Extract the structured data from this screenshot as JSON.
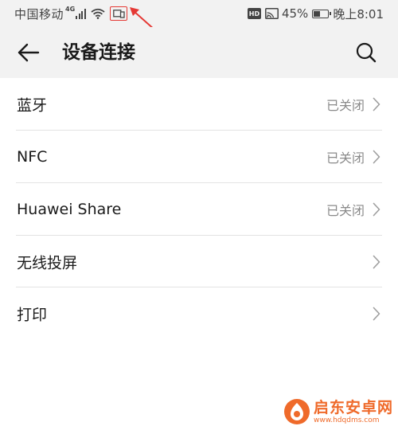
{
  "status_bar": {
    "carrier": "中国移动",
    "network_type": "4G",
    "battery_percent_label": "45%",
    "battery_level": 0.45,
    "hd_badge": "HD",
    "time": "晚上8:01",
    "icons": [
      "signal-icon",
      "wifi-icon",
      "screen-cast-icon",
      "cast-icon",
      "battery-icon"
    ]
  },
  "header": {
    "title": "设备连接",
    "back_icon": "back-arrow-icon",
    "search_icon": "search-icon"
  },
  "list": {
    "items": [
      {
        "label": "蓝牙",
        "status": "已关闭"
      },
      {
        "label": "NFC",
        "status": "已关闭"
      },
      {
        "label": "Huawei Share",
        "status": "已关闭"
      },
      {
        "label": "无线投屏",
        "status": ""
      },
      {
        "label": "打印",
        "status": ""
      }
    ]
  },
  "watermark": {
    "name": "启东安卓网",
    "url": "www.hdqdms.com"
  },
  "colors": {
    "background": "#ffffff",
    "bar_background": "#f2f2f2",
    "annotation_red": "#e53935",
    "watermark_orange": "#ef6a2a",
    "secondary_text": "#8a8a8a"
  }
}
